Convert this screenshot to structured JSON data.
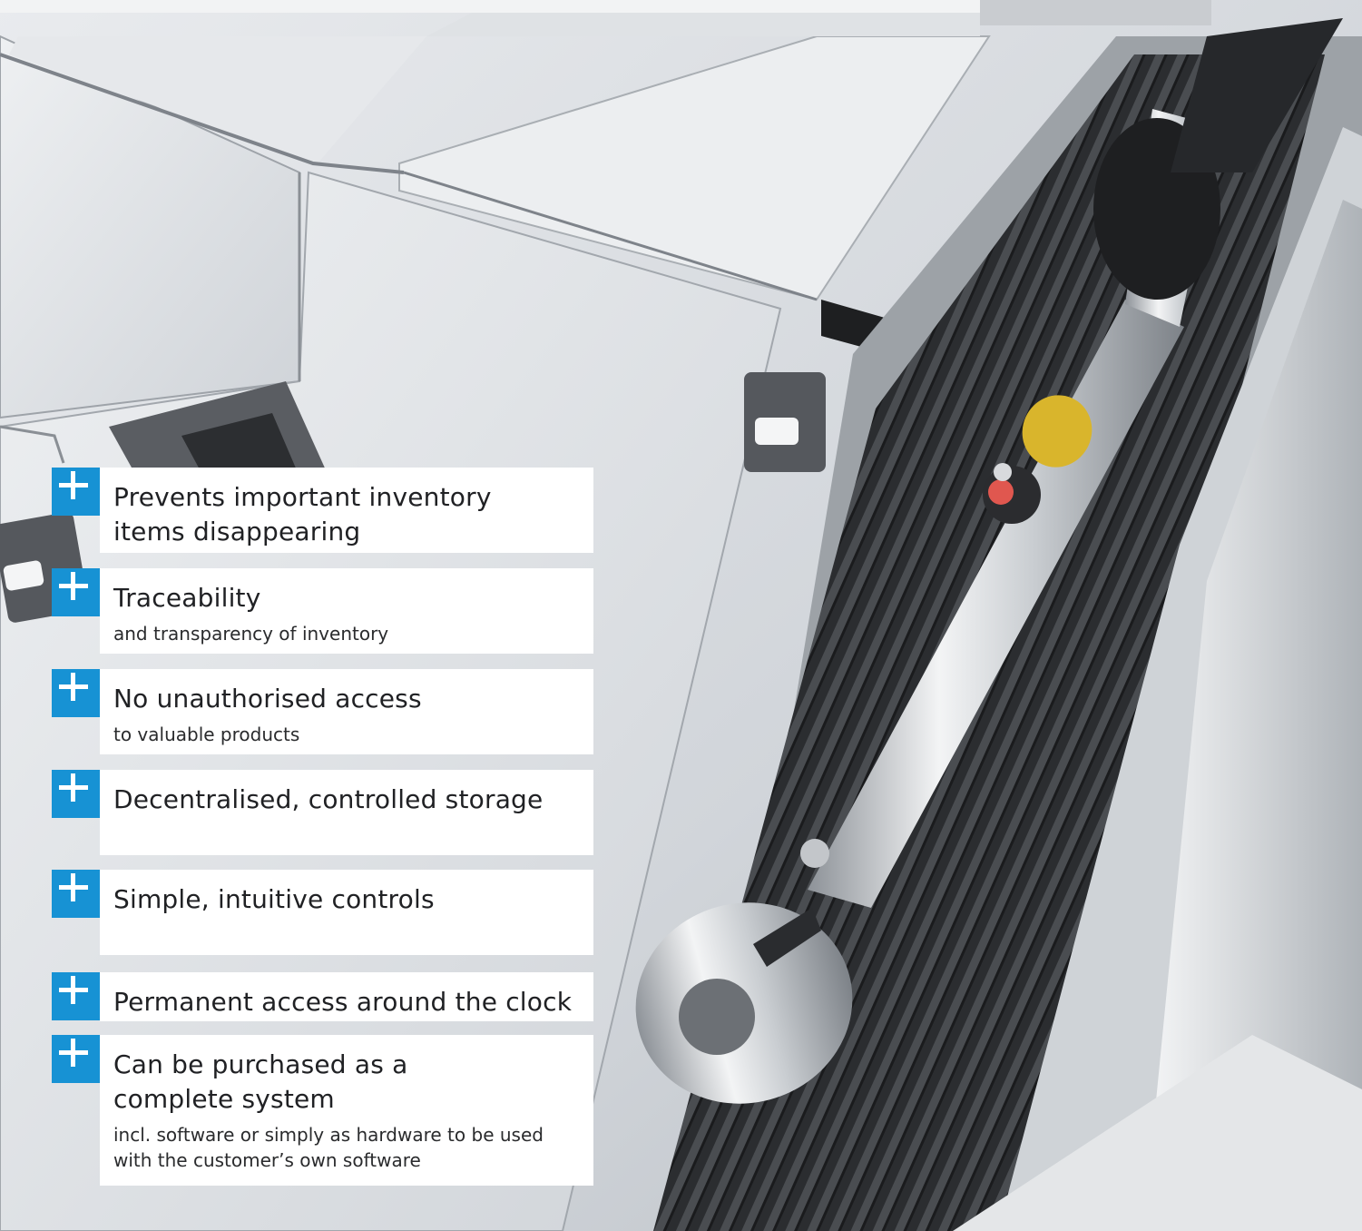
{
  "features": [
    {
      "title": "Prevents important inventory items disappearing",
      "subtitle": ""
    },
    {
      "title": "Traceability",
      "subtitle": "and transparency of inventory"
    },
    {
      "title": "No unauthorised access",
      "subtitle": "to valuable products"
    },
    {
      "title": "Decentralised, controlled storage",
      "subtitle": ""
    },
    {
      "title": "Simple, intuitive controls",
      "subtitle": ""
    },
    {
      "title": "Permanent access around the clock",
      "subtitle": ""
    },
    {
      "title": "Can be purchased as a complete system",
      "subtitle": "incl. software or simply as hardware to be used with the customer’s own software"
    }
  ],
  "colors": {
    "accent": "#1792d4",
    "panel": "#ffffff",
    "text": "#202124"
  },
  "icons": {
    "bullet": "plus-icon"
  },
  "photo": {
    "subject": "open locker drawer with torque wrench on ribbed mat"
  }
}
